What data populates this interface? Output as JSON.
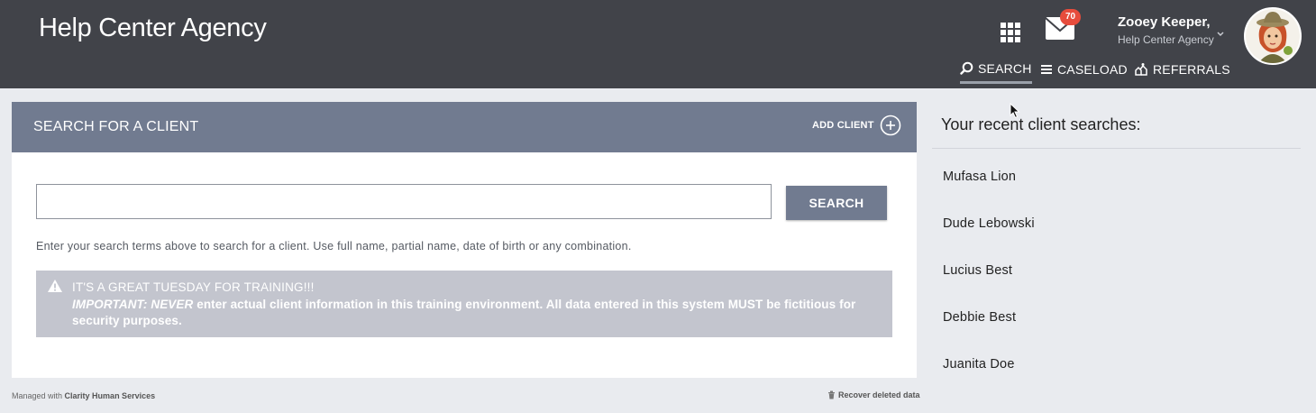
{
  "header": {
    "brand": "Help Center Agency",
    "mail_count": "70",
    "user_name": "Zooey Keeper,",
    "user_agency": "Help Center Agency",
    "nav": [
      {
        "label": "SEARCH",
        "icon": "search-icon",
        "active": true
      },
      {
        "label": "CASELOAD",
        "icon": "list-icon",
        "active": false
      },
      {
        "label": "REFERRALS",
        "icon": "referrals-icon",
        "active": false
      }
    ]
  },
  "search_panel": {
    "title": "SEARCH FOR A CLIENT",
    "add_client_label": "ADD CLIENT",
    "input_value": "",
    "search_button": "SEARCH",
    "hint": "Enter your search terms above to search for a client. Use full name, partial name, date of birth or any combination.",
    "alert": {
      "title": "IT'S A GREAT TUESDAY FOR TRAINING!!!",
      "important_label": "IMPORTANT: NEVER",
      "body": " enter actual client information in this training environment. All data entered in this system MUST be fictitious for security purposes."
    }
  },
  "recent": {
    "title": "Your recent client searches:",
    "items": [
      "Mufasa Lion",
      "Dude Lebowski",
      "Lucius Best",
      "Debbie Best",
      "Juanita Doe"
    ]
  },
  "footer": {
    "managed_prefix": "Managed with ",
    "managed_brand": "Clarity Human Services",
    "recover": "Recover deleted data"
  },
  "colors": {
    "header_bg": "#414349",
    "panel_head": "#717b90",
    "alert_bg": "#c3c5ce",
    "badge": "#e74c3c"
  }
}
